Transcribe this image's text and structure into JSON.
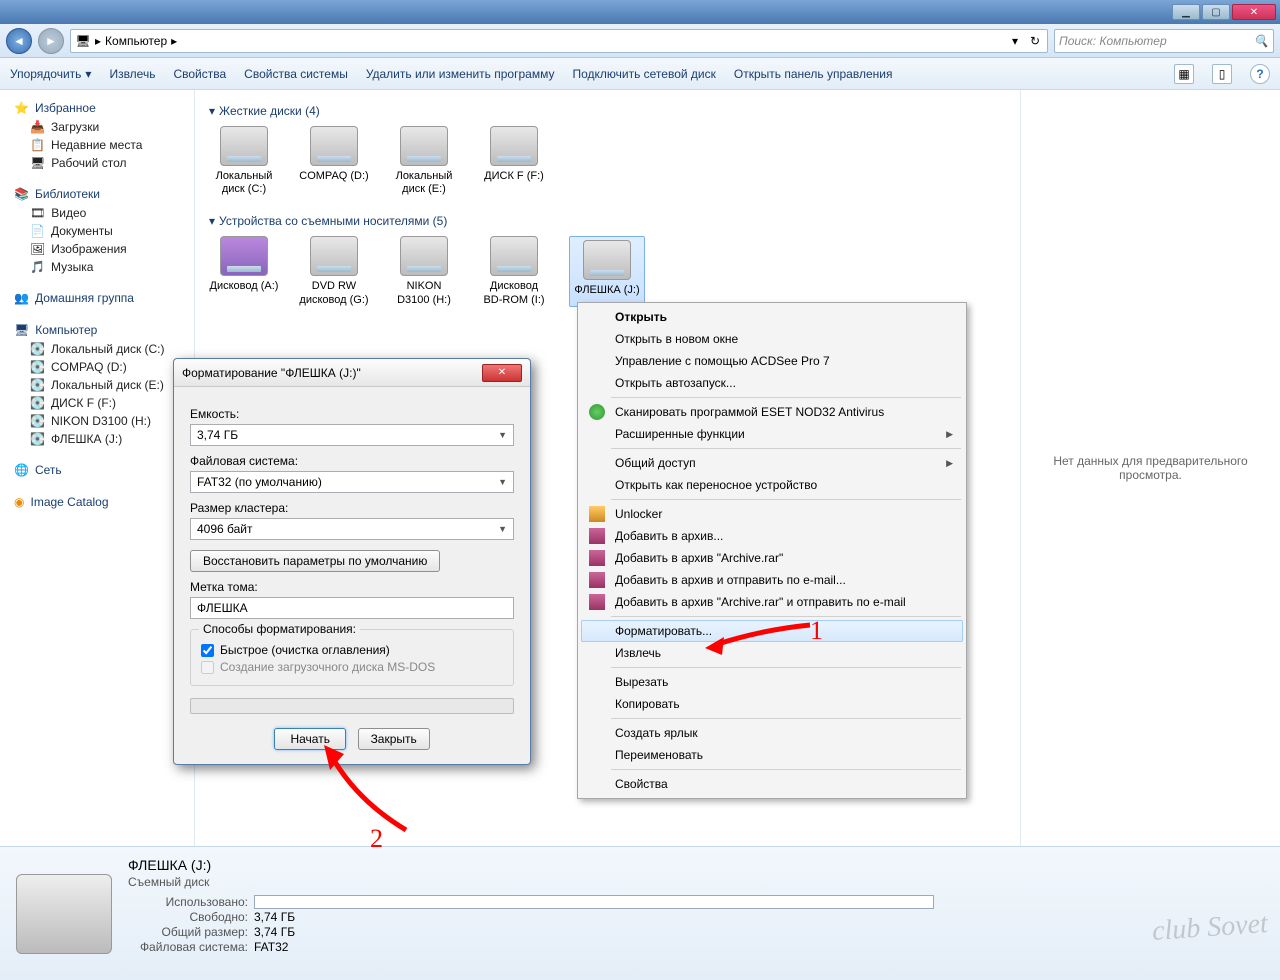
{
  "window": {
    "min": "▁",
    "max": "▢",
    "close": "✕"
  },
  "nav": {
    "back": "◄",
    "fwd": "►",
    "path_root": "Компьютер",
    "path_sep": "▸",
    "refresh": "↻",
    "dropdown": "▾",
    "search_placeholder": "Поиск: Компьютер",
    "search_icon": "🔍"
  },
  "toolbar": {
    "organize": "Упорядочить",
    "extract": "Извлечь",
    "properties": "Свойства",
    "sys_properties": "Свойства системы",
    "uninstall": "Удалить или изменить программу",
    "map_drive": "Подключить сетевой диск",
    "control_panel": "Открыть панель управления",
    "view_icon": "▦",
    "preview_icon": "▯",
    "help_icon": "?"
  },
  "sidebar": {
    "favorites": "Избранное",
    "downloads": "Загрузки",
    "recent": "Недавние места",
    "desktop": "Рабочий стол",
    "libraries": "Библиотеки",
    "videos": "Видео",
    "documents": "Документы",
    "pictures": "Изображения",
    "music": "Музыка",
    "homegroup": "Домашняя группа",
    "computer": "Компьютер",
    "local_c": "Локальный диск (C:)",
    "compaq_d": "COMPAQ (D:)",
    "local_e": "Локальный диск (E:)",
    "disk_f": "ДИСК F (F:)",
    "nikon_h": "NIKON D3100 (H:)",
    "flash_j": "ФЛЕШКА (J:)",
    "network": "Сеть",
    "catalog": "Image Catalog"
  },
  "sections": {
    "hdd": "Жесткие диски (4)",
    "removable": "Устройства со съемными носителями (5)"
  },
  "drives": {
    "c": "Локальный диск (C:)",
    "d": "COMPAQ (D:)",
    "e": "Локальный диск (E:)",
    "f": "ДИСК F (F:)",
    "a": "Дисковод (A:)",
    "g": "DVD RW дисковод (G:)",
    "h": "NIKON D3100 (H:)",
    "i": "Дисковод BD-ROM (I:)",
    "j": "ФЛЕШКА (J:)"
  },
  "preview": {
    "empty": "Нет данных для предварительного просмотра."
  },
  "ctx": {
    "open": "Открыть",
    "open_new": "Открыть в новом окне",
    "acdsee": "Управление с помощью ACDSee Pro 7",
    "autorun": "Открыть автозапуск...",
    "eset": "Сканировать программой ESET NOD32 Antivirus",
    "eset_adv": "Расширенные функции",
    "share": "Общий доступ",
    "portable": "Открыть как переносное устройство",
    "unlocker": "Unlocker",
    "rar1": "Добавить в архив...",
    "rar2": "Добавить в архив \"Archive.rar\"",
    "rar3": "Добавить в архив и отправить по e-mail...",
    "rar4": "Добавить в архив \"Archive.rar\" и отправить по e-mail",
    "format": "Форматировать...",
    "eject": "Извлечь",
    "cut": "Вырезать",
    "copy": "Копировать",
    "shortcut": "Создать ярлык",
    "rename": "Переименовать",
    "props": "Свойства"
  },
  "arrows": {
    "one": "1",
    "two": "2"
  },
  "dialog": {
    "title": "Форматирование \"ФЛЕШКА (J:)\"",
    "capacity_lbl": "Емкость:",
    "capacity_val": "3,74 ГБ",
    "fs_lbl": "Файловая система:",
    "fs_val": "FAT32 (по умолчанию)",
    "cluster_lbl": "Размер кластера:",
    "cluster_val": "4096 байт",
    "restore": "Восстановить параметры по умолчанию",
    "label_lbl": "Метка тома:",
    "label_val": "ФЛЕШКА",
    "methods": "Способы форматирования:",
    "quick": "Быстрое (очистка оглавления)",
    "msdos": "Создание загрузочного диска MS-DOS",
    "start": "Начать",
    "close": "Закрыть"
  },
  "status": {
    "title": "ФЛЕШКА (J:)",
    "subtitle": "Съемный диск",
    "used_lbl": "Использовано:",
    "free_lbl": "Свободно:",
    "free_val": "3,74 ГБ",
    "total_lbl": "Общий размер:",
    "total_val": "3,74 ГБ",
    "fs_lbl": "Файловая система:",
    "fs_val": "FAT32"
  },
  "watermark": "club Sovet"
}
